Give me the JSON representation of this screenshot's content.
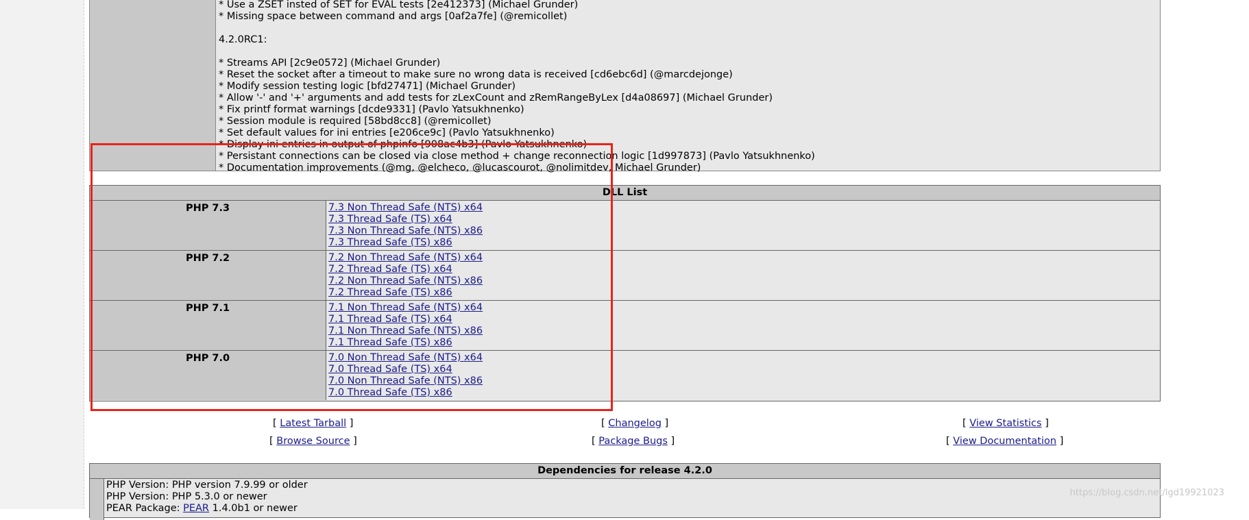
{
  "release_notes": {
    "lines": [
      "* Use a ZSET insted of SET for EVAL tests [2e412373] (Michael Grunder)",
      "* Missing space between command and args [0af2a7fe] (@remicollet)",
      "",
      "4.2.0RC1:",
      "",
      "* Streams API [2c9e0572] (Michael Grunder)",
      "* Reset the socket after a timeout to make sure no wrong data is received [cd6ebc6d] (@marcdejonge)",
      "* Modify session testing logic [bfd27471] (Michael Grunder)",
      "* Allow '-' and '+' arguments and add tests for zLexCount and zRemRangeByLex [d4a08697] (Michael Grunder)",
      "* Fix printf format warnings [dcde9331] (Pavlo Yatsukhnenko)",
      "* Session module is required [58bd8cc8] (@remicollet)",
      "* Set default values for ini entries [e206ce9c] (Pavlo Yatsukhnenko)",
      "* Display ini entries in output of phpinfo [908ac4b3] (Pavlo Yatsukhnenko)",
      "* Persistant connections can be closed via close method + change reconnection logic [1d997873] (Pavlo Yatsukhnenko)",
      "* Documentation improvements (@mg, @elcheco, @lucascourot, @nolimitdev, Michael Grunder)"
    ]
  },
  "dll_list": {
    "title": "DLL List",
    "rows": [
      {
        "version": "PHP 7.3",
        "links": [
          "7.3 Non Thread Safe (NTS) x64",
          "7.3 Thread Safe (TS) x64",
          "7.3 Non Thread Safe (NTS) x86",
          "7.3 Thread Safe (TS) x86"
        ]
      },
      {
        "version": "PHP 7.2",
        "links": [
          "7.2 Non Thread Safe (NTS) x64",
          "7.2 Thread Safe (TS) x64",
          "7.2 Non Thread Safe (NTS) x86",
          "7.2 Thread Safe (TS) x86"
        ]
      },
      {
        "version": "PHP 7.1",
        "links": [
          "7.1 Non Thread Safe (NTS) x64",
          "7.1 Thread Safe (TS) x64",
          "7.1 Non Thread Safe (NTS) x86",
          "7.1 Thread Safe (TS) x86"
        ]
      },
      {
        "version": "PHP 7.0",
        "links": [
          "7.0 Non Thread Safe (NTS) x64",
          "7.0 Thread Safe (TS) x64",
          "7.0 Non Thread Safe (NTS) x86",
          "7.0 Thread Safe (TS) x86"
        ]
      }
    ]
  },
  "nav": {
    "latest_tarball": "Latest Tarball",
    "changelog": "Changelog",
    "view_statistics": "View Statistics",
    "browse_source": "Browse Source",
    "package_bugs": "Package Bugs",
    "view_documentation": "View Documentation"
  },
  "dependencies": {
    "title": "Dependencies for release 4.2.0",
    "line1": "PHP Version: PHP version 7.9.99 or older",
    "line2": "PHP Version: PHP 5.3.0 or newer",
    "line3_prefix": "PEAR Package: ",
    "line3_link": "PEAR",
    "line3_suffix": " 1.4.0b1 or newer"
  },
  "watermark": "https://blog.csdn.net/lgd19921023",
  "colors": {
    "link": "#1a1a8c",
    "highlight_box": "#e8231a",
    "cell_dark": "#c8c8c8",
    "cell_light": "#e8e8e8"
  }
}
